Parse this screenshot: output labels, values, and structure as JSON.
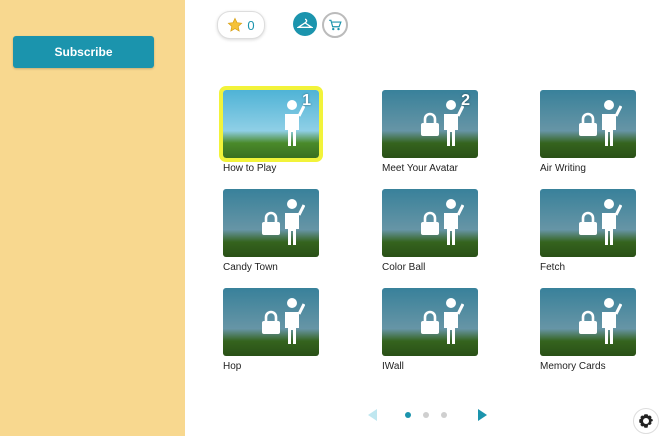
{
  "sidebar": {
    "subscribe_label": "Subscribe"
  },
  "header": {
    "stars": "0",
    "icons": [
      "star-icon",
      "hanger-icon",
      "cart-icon"
    ]
  },
  "activities": [
    {
      "label": "How to Play",
      "badge": "1",
      "locked": false,
      "selected": true
    },
    {
      "label": "Meet Your Avatar",
      "badge": "2",
      "locked": true,
      "selected": false
    },
    {
      "label": "Air Writing",
      "locked": true,
      "selected": false
    },
    {
      "label": "Candy Town",
      "locked": true,
      "selected": false
    },
    {
      "label": "Color Ball",
      "locked": true,
      "selected": false
    },
    {
      "label": "Fetch",
      "locked": true,
      "selected": false
    },
    {
      "label": "Hop",
      "locked": true,
      "selected": false
    },
    {
      "label": "IWall",
      "locked": true,
      "selected": false
    },
    {
      "label": "Memory Cards",
      "locked": true,
      "selected": false
    }
  ],
  "pagination": {
    "pages": 3,
    "current": 1
  },
  "colors": {
    "accent": "#1b94ad",
    "sidebar": "#f8d88f",
    "selected": "#f2f33a"
  }
}
